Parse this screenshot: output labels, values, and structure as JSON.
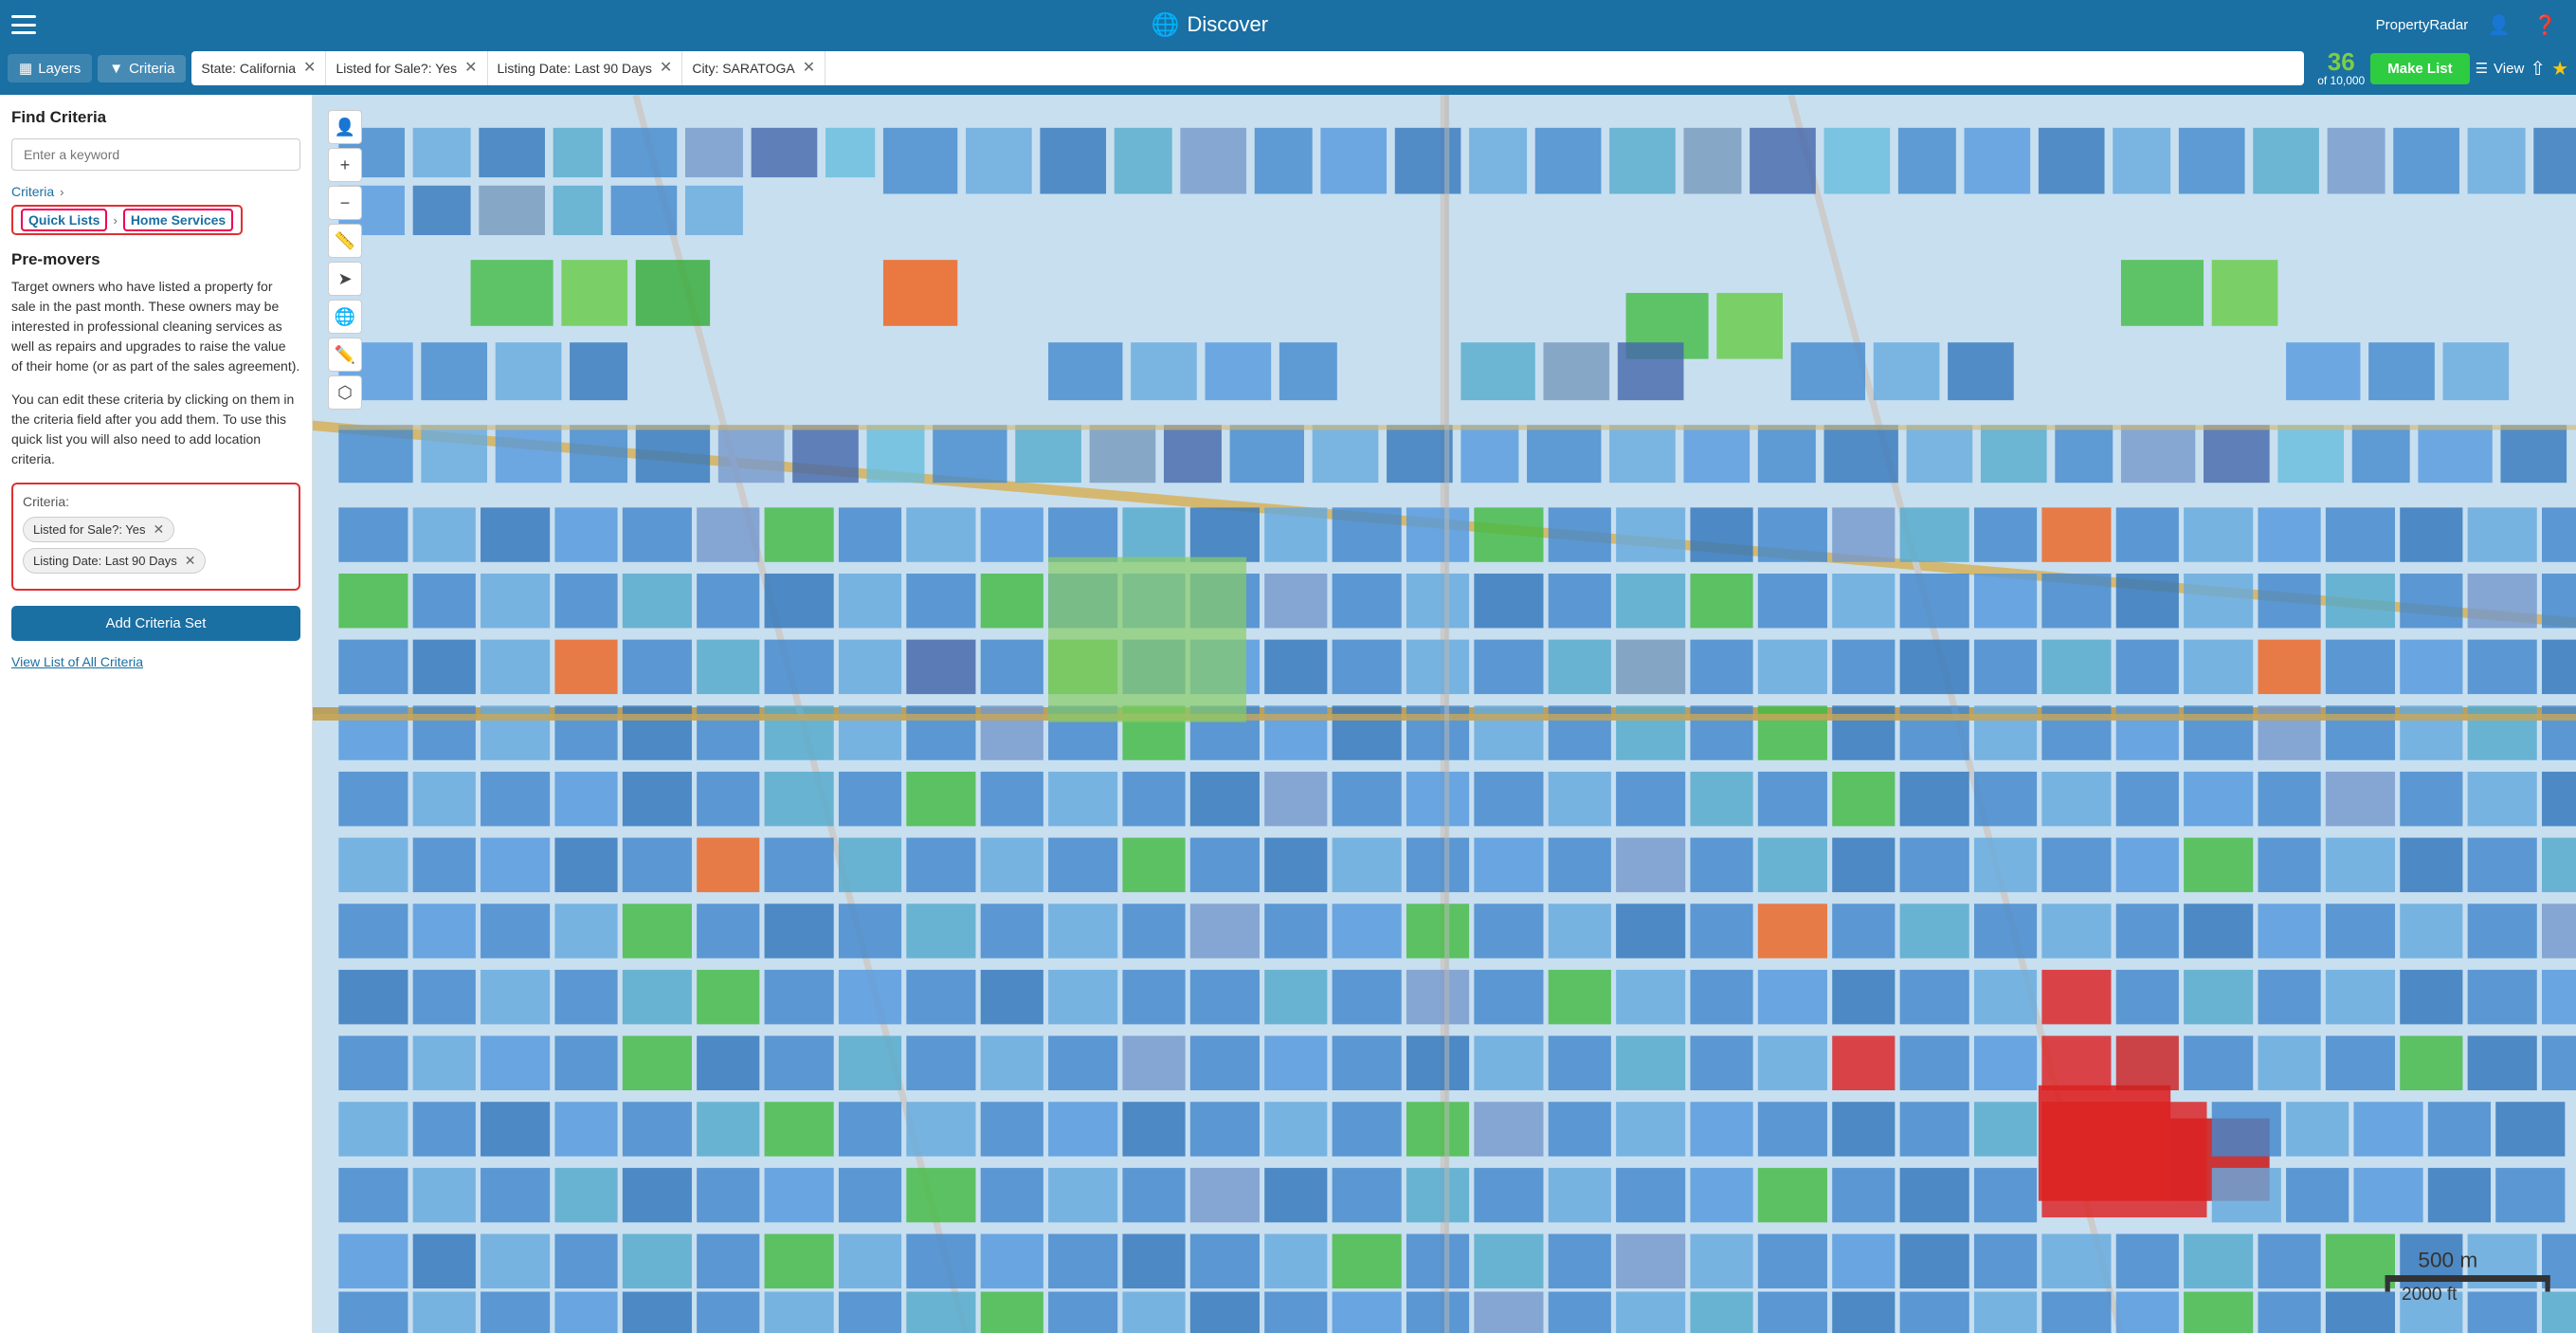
{
  "app": {
    "title": "Discover",
    "user": "PropertyRadar"
  },
  "topbar": {
    "title": "Discover",
    "user_label": "PropertyRadar",
    "help_icon": "?",
    "share_icon": "⇧",
    "star_icon": "★",
    "list_icon": "☰",
    "view_label": "View"
  },
  "filterbar": {
    "layers_label": "Layers",
    "criteria_label": "Criteria",
    "filters": [
      {
        "id": "f1",
        "text": "State: California"
      },
      {
        "id": "f2",
        "text": "Listed for Sale?: Yes"
      },
      {
        "id": "f3",
        "text": "Listing Date: Last 90 Days"
      },
      {
        "id": "f4",
        "text": "City: SARATOGA"
      }
    ],
    "count": "36",
    "count_of": "of 10,000",
    "make_list_label": "Make List",
    "view_label": "View"
  },
  "sidebar": {
    "find_criteria_title": "Find Criteria",
    "search_placeholder": "Enter a keyword",
    "breadcrumb": [
      {
        "id": "bc1",
        "label": "Criteria",
        "active": false
      },
      {
        "id": "bc2",
        "label": "Quick Lists",
        "active": true
      },
      {
        "id": "bc3",
        "label": "Home Services",
        "active": true
      }
    ],
    "section_title": "Pre-movers",
    "section_desc_1": "Target owners who have listed a property for sale in the past month. These owners may be interested in professional cleaning services as well as repairs and upgrades to raise the value of their home (or as part of the sales agreement).",
    "section_desc_2": "You can edit these criteria by clicking on them in the criteria field after you add them. To use this quick list you will also need to add location criteria.",
    "criteria_label": "Criteria:",
    "criteria_tags": [
      {
        "id": "ct1",
        "text": "Listed for Sale?: Yes"
      },
      {
        "id": "ct2",
        "text": "Listing Date: Last 90 Days"
      }
    ],
    "add_criteria_btn": "Add Criteria Set",
    "view_all_link": "View List of All Criteria"
  },
  "map": {
    "scale_label_metric": "500 m",
    "scale_label_imperial": "2000 ft"
  }
}
